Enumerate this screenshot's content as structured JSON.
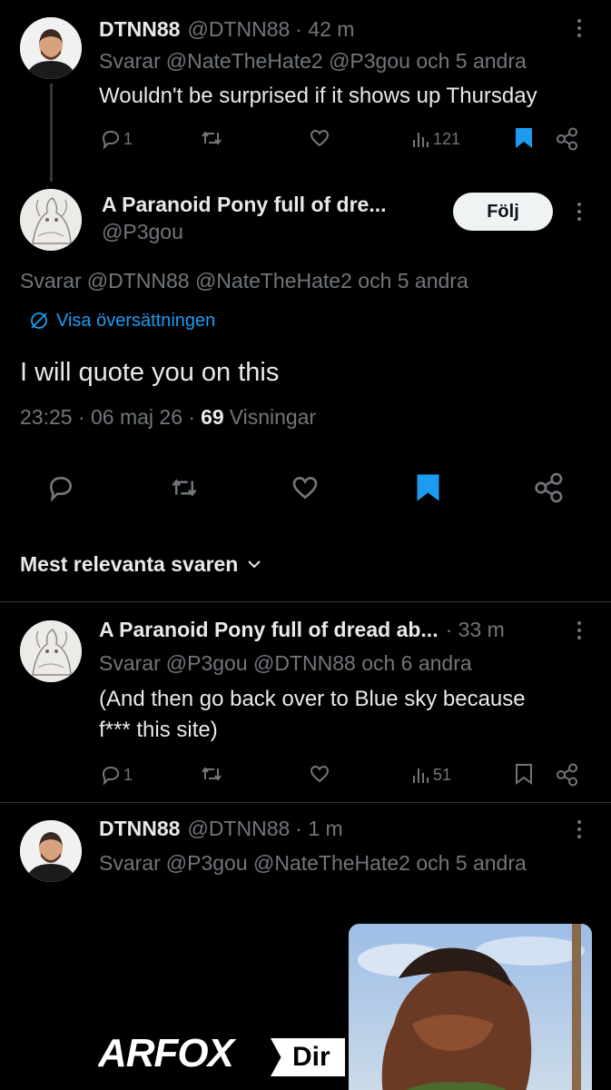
{
  "tweets": [
    {
      "name": "DTNN88",
      "handle": "@DTNN88",
      "time": "· 42 m",
      "reply_prefix": "Svarar",
      "reply_to": "@NateTheHate2 @P3gou och 5 andra",
      "text": "Wouldn't be surprised if it shows up Thursday",
      "replies": "1",
      "views": "121",
      "bookmarked": true
    },
    {
      "name": "A Paranoid Pony full of dre...",
      "handle": "@P3gou",
      "follow_label": "Följ",
      "reply_prefix": "Svarar",
      "reply_to": "@DTNN88 @NateTheHate2 och 5 andra",
      "translate": "Visa översättningen",
      "text": "I will quote you on this",
      "timestamp": "23:25 · 06 maj 26 ·",
      "views_count": "69",
      "views_label": "Visningar",
      "bookmarked": true
    },
    {
      "name": "A Paranoid Pony full of dread ab...",
      "time": "· 33 m",
      "reply_prefix": "Svarar",
      "reply_to": "@P3gou @DTNN88 och 6 andra",
      "text_line1": "(And then go back over to Blue sky because",
      "text_line2": "f*** this site)",
      "replies": "1",
      "views": "51",
      "bookmarked": false
    },
    {
      "name": "DTNN88",
      "handle": "@DTNN88",
      "time": "· 1 m",
      "reply_prefix": "Svarar",
      "reply_to": "@P3gou @NateTheHate2 och 5 andra"
    }
  ],
  "sort_label": "Mest relevanta svaren",
  "media_text_1": "ARFOX",
  "media_text_2": "Dir",
  "colors": {
    "accent": "#1d9bf0",
    "muted": "#71767b",
    "text": "#e7e9ea",
    "divider": "#2f3336"
  }
}
